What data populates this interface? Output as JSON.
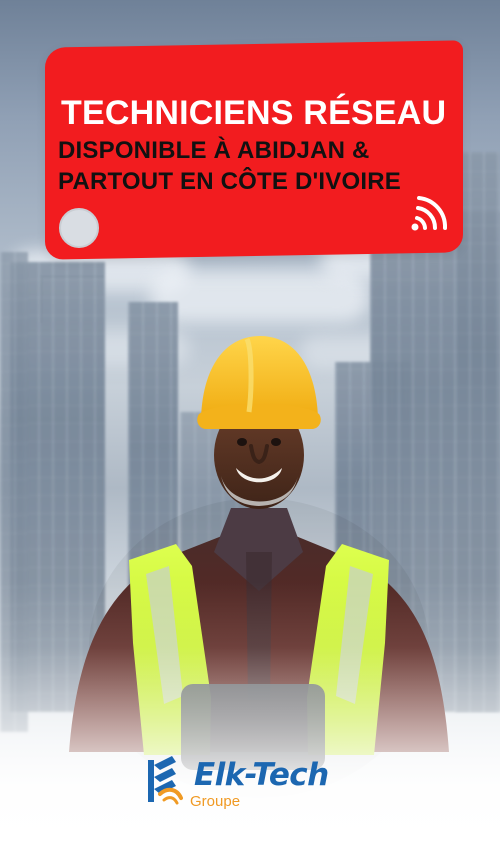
{
  "banner": {
    "line1": "TECHNICIENS RÉSEAU",
    "line2": "DISPONIBLE À ABIDJAN &",
    "line3": "PARTOUT  EN CÔTE D'IVOIRE",
    "signal_icon": "signal-icon",
    "colors": {
      "banner": "#f21c1f",
      "primary_text": "#ffffff",
      "secondary_text": "#111111"
    }
  },
  "logo": {
    "title": "Elk-Tech",
    "subtitle": "Groupe",
    "icon": "elk-tech-logo-icon",
    "colors": {
      "title": "#1c67b1",
      "subtitle": "#f09a24"
    }
  },
  "scene": {
    "worker_icon": "construction-worker",
    "hard_hat_color": "#f5b21f",
    "vest_color": "#c8f31a",
    "shirt_color": "#6a1f18"
  }
}
